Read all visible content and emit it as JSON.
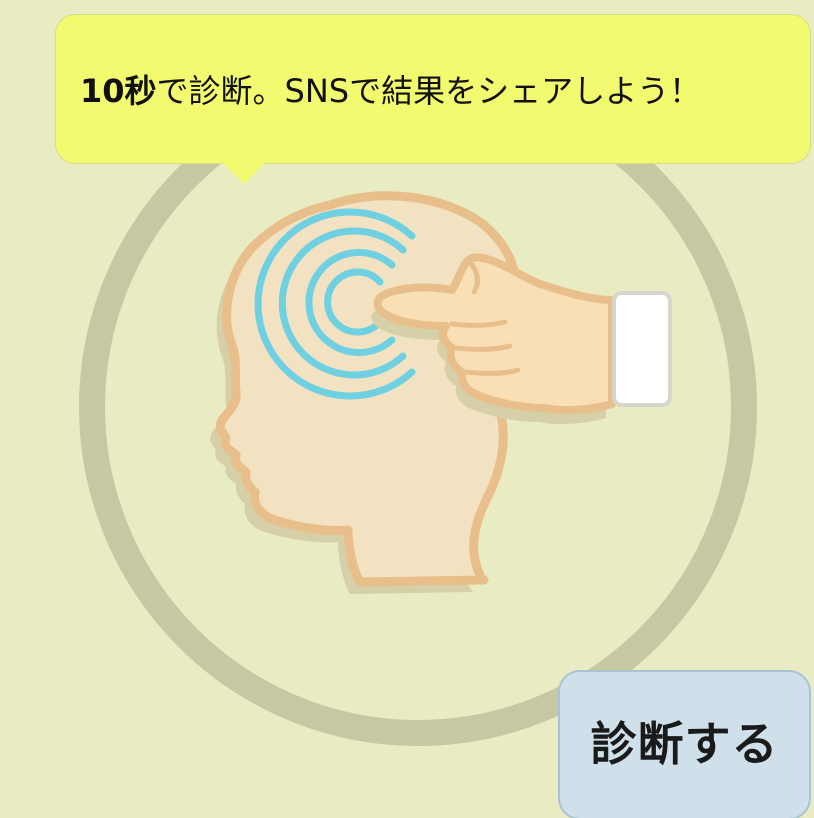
{
  "speech_bubble": {
    "highlight": "10秒",
    "message": "で診断。SNSで結果をシェアしよう！"
  },
  "diagnose_button": {
    "label": "診断する"
  },
  "illustration": {
    "icon": "head-thinking-icon"
  },
  "colors": {
    "background": "#e9ebc3",
    "bubble": "#f2fa6f",
    "button": "#cfe0ea",
    "ring": "#c6c8a3",
    "skin": "#f3e2c1",
    "skin_outline": "#e8bf8a",
    "waves": "#6fd0e2"
  }
}
